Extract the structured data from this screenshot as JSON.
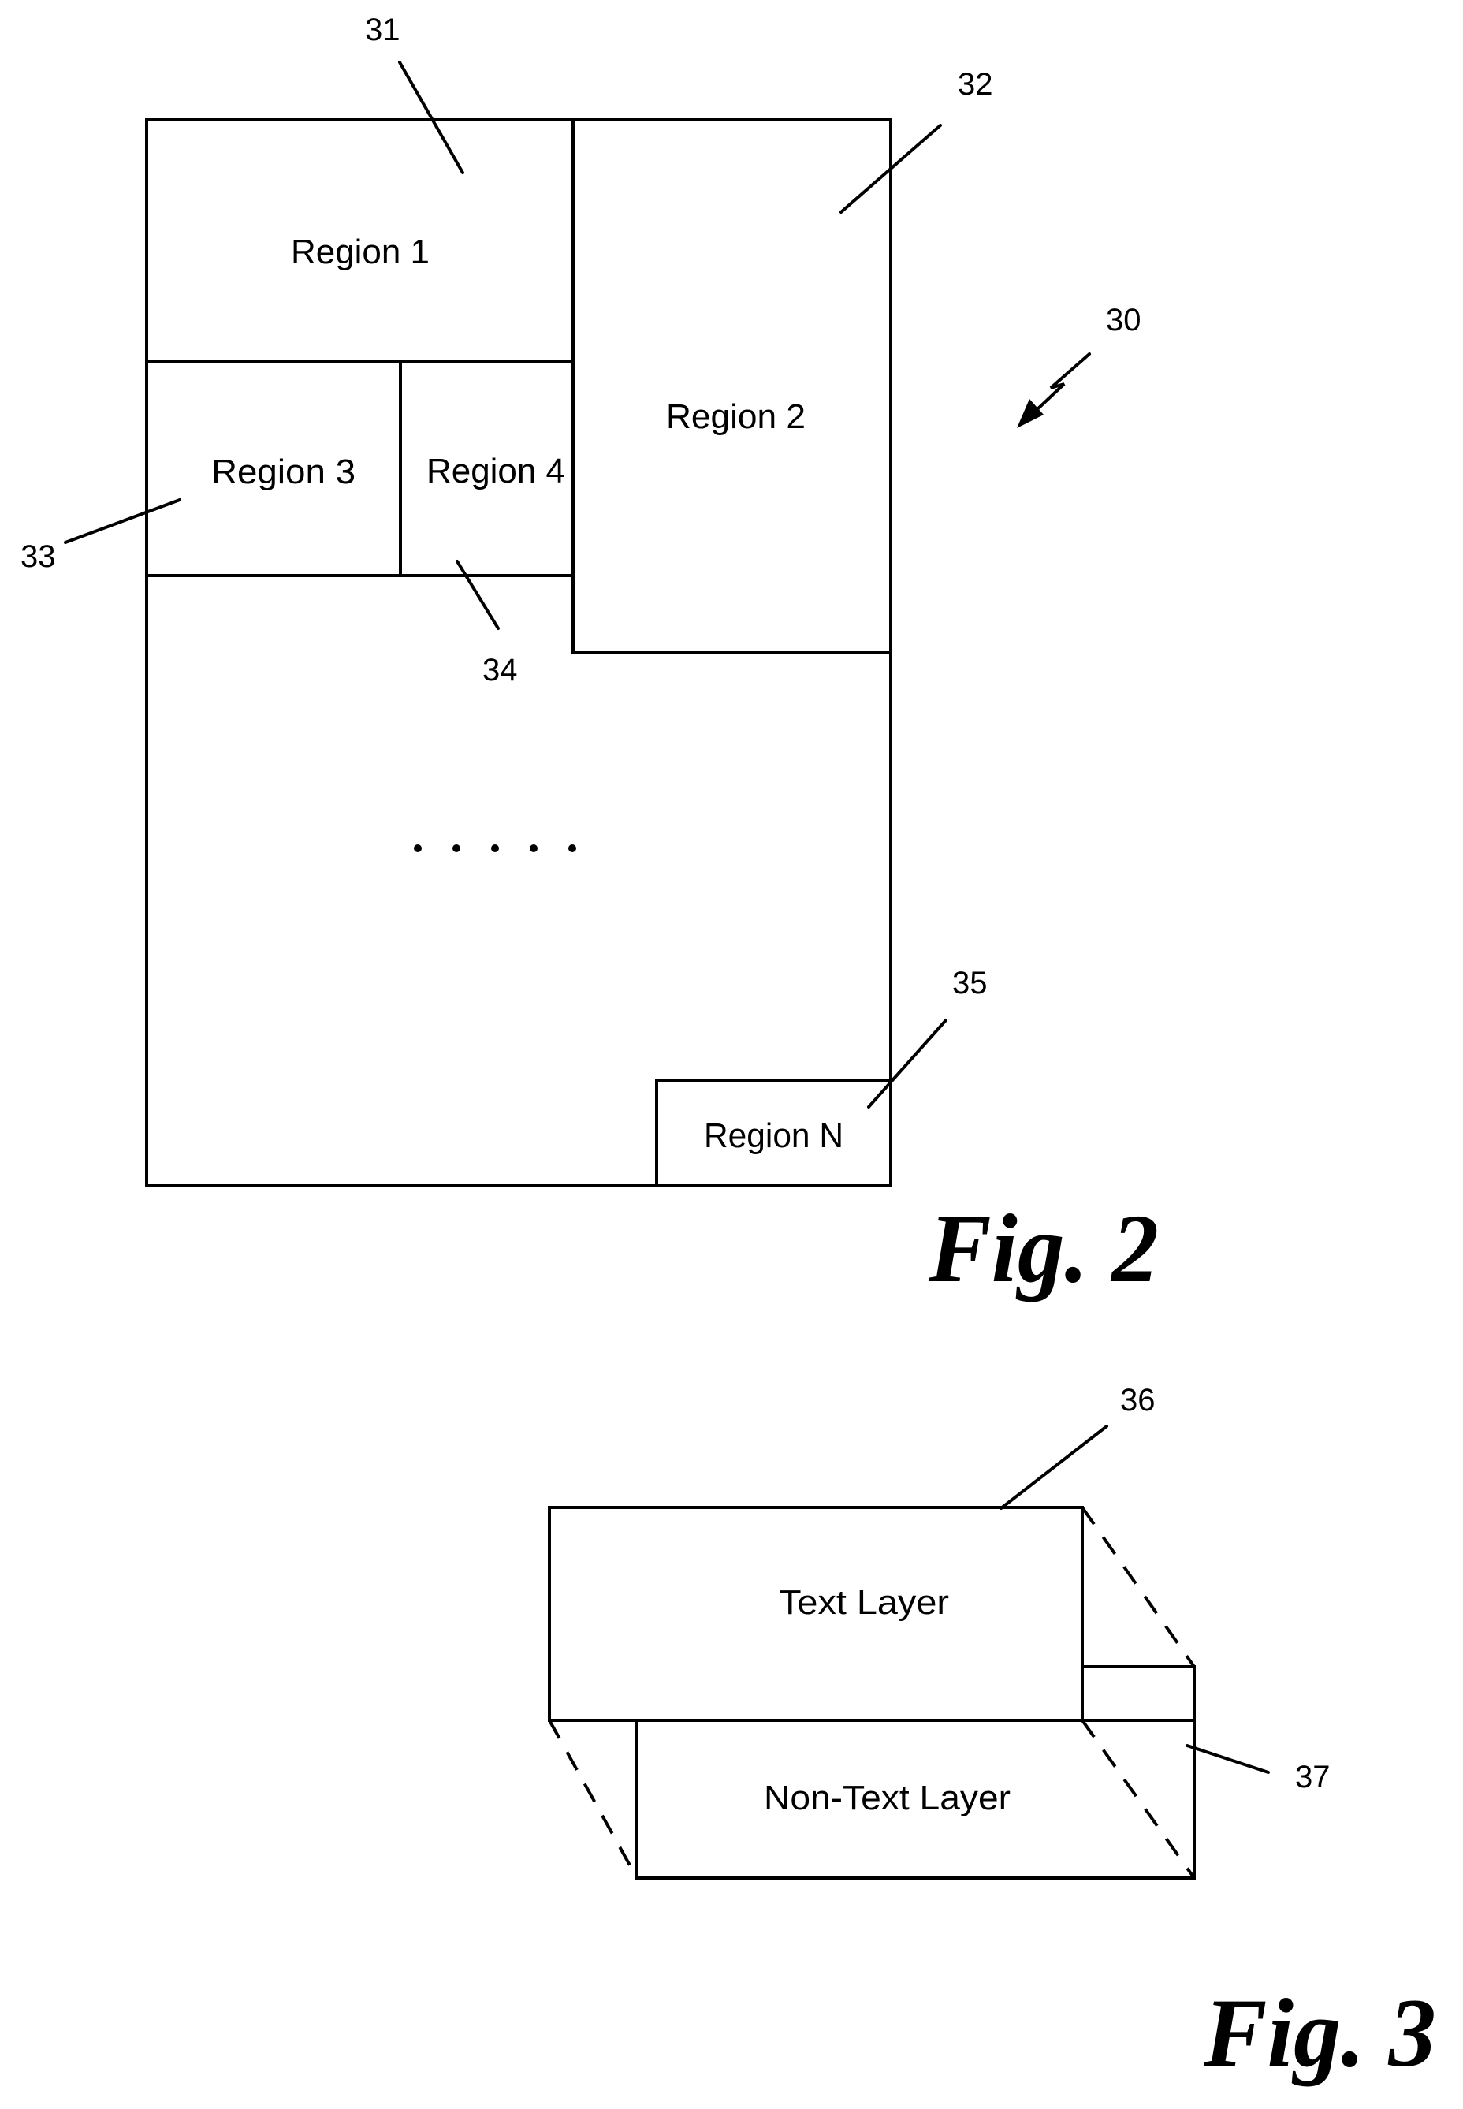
{
  "figure2": {
    "caption": "Fig. 2",
    "page_ref": "30",
    "regions": [
      {
        "label": "Region 1",
        "ref": "31"
      },
      {
        "label": "Region 2",
        "ref": "32"
      },
      {
        "label": "Region 3",
        "ref": "33"
      },
      {
        "label": "Region 4",
        "ref": "34"
      },
      {
        "label": "Region N",
        "ref": "35"
      }
    ],
    "ellipsis": "• • • • •"
  },
  "figure3": {
    "caption": "Fig. 3",
    "layers": [
      {
        "label": "Text Layer",
        "ref": "36"
      },
      {
        "label": "Non-Text Layer",
        "ref": "37"
      }
    ]
  }
}
